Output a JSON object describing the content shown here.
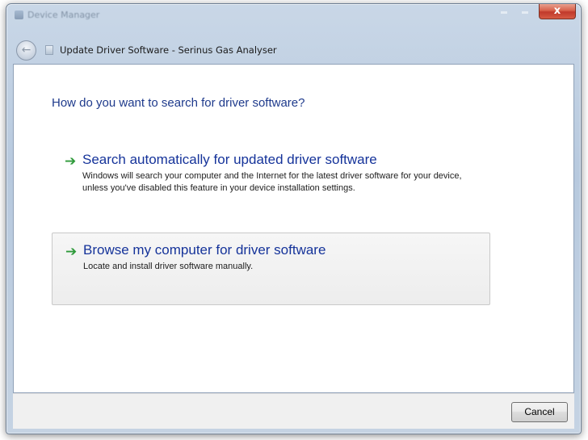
{
  "window": {
    "app_title": "Device Manager",
    "close_glyph": "x"
  },
  "nav": {
    "back_glyph": "←",
    "wizard_title": "Update Driver Software - Serinus Gas Analyser"
  },
  "main": {
    "heading": "How do you want to search for driver software?",
    "options": [
      {
        "title": "Search automatically for updated driver software",
        "description": "Windows will search your computer and the Internet for the latest driver software for your device, unless you've disabled this feature in your device installation settings."
      },
      {
        "title": "Browse my computer for driver software",
        "description": "Locate and install driver software manually."
      }
    ],
    "arrow_glyph": "➔"
  },
  "footer": {
    "cancel_label": "Cancel"
  },
  "colors": {
    "heading": "#1e3a8c",
    "link": "#15339a",
    "arrow": "#2e9a3a",
    "close": "#c0392b"
  }
}
